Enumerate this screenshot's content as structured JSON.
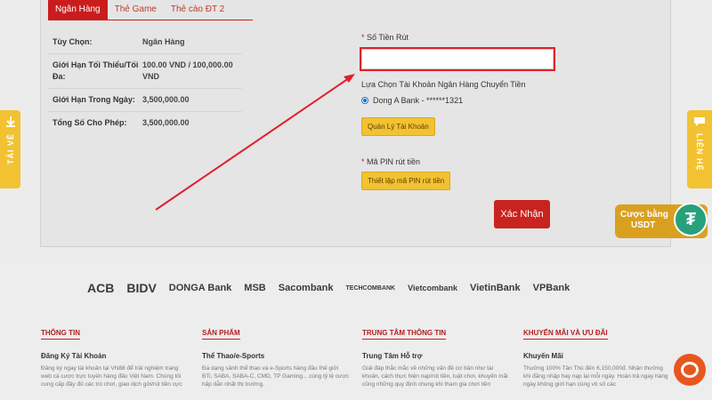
{
  "tabs": [
    {
      "label": "Ngân Hàng",
      "active": true
    },
    {
      "label": "Thẻ Game",
      "active": false
    },
    {
      "label": "Thẻ cào ĐT 2",
      "active": false
    }
  ],
  "info": [
    {
      "key": "Tùy Chọn:",
      "value": "Ngân Hàng"
    },
    {
      "key": "Giới Hạn Tối Thiểu/Tối Đa:",
      "value": "100.00 VND / 100,000.00 VND"
    },
    {
      "key": "Giới Hạn Trong Ngày:",
      "value": "3,500,000.00"
    },
    {
      "key": "Tổng Số Cho Phép:",
      "value": "3,500,000.00"
    }
  ],
  "form": {
    "amount_label": "Số Tiền Rút",
    "amount_value": "",
    "bank_label": "Lựa Chọn Tài Khoản Ngân Hàng Chuyển Tiền",
    "bank_option": "Dong A Bank - ******1321",
    "manage_btn": "Quản Lý Tài Khoản",
    "pin_label": "Mã PIN rút tiền",
    "pin_btn": "Thiết lập mã PIN rút tiền",
    "submit_btn": "Xác Nhận"
  },
  "side": {
    "left_label": "TẢI VỀ",
    "right_label": "LIÊN HỆ",
    "usdt_line1": "Cược bằng",
    "usdt_line2": "USDT"
  },
  "banks": [
    "ACB",
    "BIDV",
    "DONGA Bank",
    "MSB",
    "Sacombank",
    "TECHCOMBANK",
    "Vietcombank",
    "VietinBank",
    "VPBank"
  ],
  "footer": [
    {
      "title": "THÔNG TIN",
      "sub": "Đăng Ký Tài Khoản",
      "text": "Đăng ký ngay tài khoản tại VN88 để trải nghiệm trang web cá cược trực tuyến hàng đầu Việt Nam. Chúng tôi cung cấp đầy đủ các trò chơi, giao dịch gửi/rút tiền cực"
    },
    {
      "title": "SẢN PHẨM",
      "sub": "Thể Thao/e-Sports",
      "text": "Đa dạng sảnh thể thao và e-Sports hàng đầu thế giới BTi, SABA, SABA-C, CMD, TP Gaming... cùng tỷ lệ cược hấp dẫn nhất thị trường."
    },
    {
      "title": "TRUNG TÂM THÔNG TIN",
      "sub": "Trung Tâm Hỗ trợ",
      "text": "Giải đáp thắc mắc về những vấn đề cơ bản như tài khoản, cách thực hiện nạp/rút tiền, luật chơi, khuyến mãi cũng những quy định chung khi tham gia chơi tiền"
    },
    {
      "title": "KHUYẾN MÃI VÀ ƯU ĐÃI",
      "sub": "Khuyến Mãi",
      "text": "Thưởng 100% Tân Thủ đến 6,150,000đ. Nhận thưởng khi đăng nhập hay nạp lại mỗi ngày. Hoàn trả ngay hàng ngày không giới hạn cùng vô số các"
    }
  ]
}
